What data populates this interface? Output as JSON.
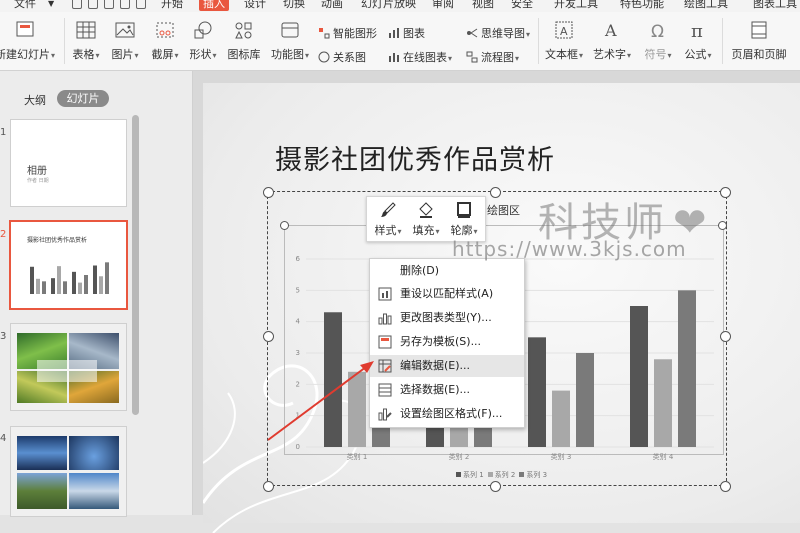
{
  "menubar": {
    "items": [
      "文件",
      "开始",
      "插入",
      "设计",
      "切换",
      "动画",
      "幻灯片放映",
      "审阅",
      "视图",
      "安全",
      "开发工具",
      "特色功能",
      "绘图工具",
      "图表工具"
    ],
    "active": "插入"
  },
  "ribbon": {
    "new_slide": "新建幻灯片",
    "table": "表格",
    "picture": "图片",
    "screenshot": "截屏",
    "shape": "形状",
    "icon_lib": "图标库",
    "func_chart": "功能图",
    "smart_art": "智能图形",
    "chart": "图表",
    "mind_map": "思维导图",
    "relation": "关系图",
    "online_chart": "在线图表",
    "flowchart": "流程图",
    "textbox": "文本框",
    "wordart": "艺术字",
    "symbol": "符号",
    "formula": "公式",
    "header_footer": "页眉和页脚"
  },
  "leftpanel": {
    "tab_outline": "大纲",
    "tab_slides": "幻灯片",
    "thumbs": [
      {
        "num": "1",
        "title": "相册",
        "sub": "作者 日期"
      },
      {
        "num": "2",
        "title": "摄影社团优秀作品赏析"
      },
      {
        "num": "3"
      },
      {
        "num": "4"
      }
    ]
  },
  "slide": {
    "title": "摄影社团优秀作品赏析"
  },
  "chart_data": {
    "type": "bar",
    "categories": [
      "类别 1",
      "类别 2",
      "类别 3",
      "类别 4"
    ],
    "series": [
      {
        "name": "系列 1",
        "values": [
          4.3,
          2.5,
          3.5,
          4.5
        ]
      },
      {
        "name": "系列 2",
        "values": [
          2.4,
          4.4,
          1.8,
          2.8
        ]
      },
      {
        "name": "系列 3",
        "values": [
          2.0,
          2.0,
          3.0,
          5.0
        ]
      }
    ],
    "ylim": [
      0,
      6
    ],
    "yticks": [
      "0",
      "1",
      "2",
      "3",
      "4",
      "5",
      "6"
    ],
    "legend_position": "bottom",
    "colors": [
      "#555555",
      "#a8a8a8",
      "#7a7a7a"
    ]
  },
  "mini_toolbar": {
    "style": "样式",
    "fill": "填充",
    "outline": "轮廓",
    "plot_area": "绘图区"
  },
  "context_menu": {
    "items": [
      "删除(D)",
      "重设以匹配样式(A)",
      "更改图表类型(Y)...",
      "另存为模板(S)...",
      "编辑数据(E)...",
      "选择数据(E)...",
      "设置绘图区格式(F)..."
    ],
    "hovered_index": 4
  },
  "watermark": {
    "line1": "科技师",
    "line2": "https://www.3kjs.com"
  }
}
